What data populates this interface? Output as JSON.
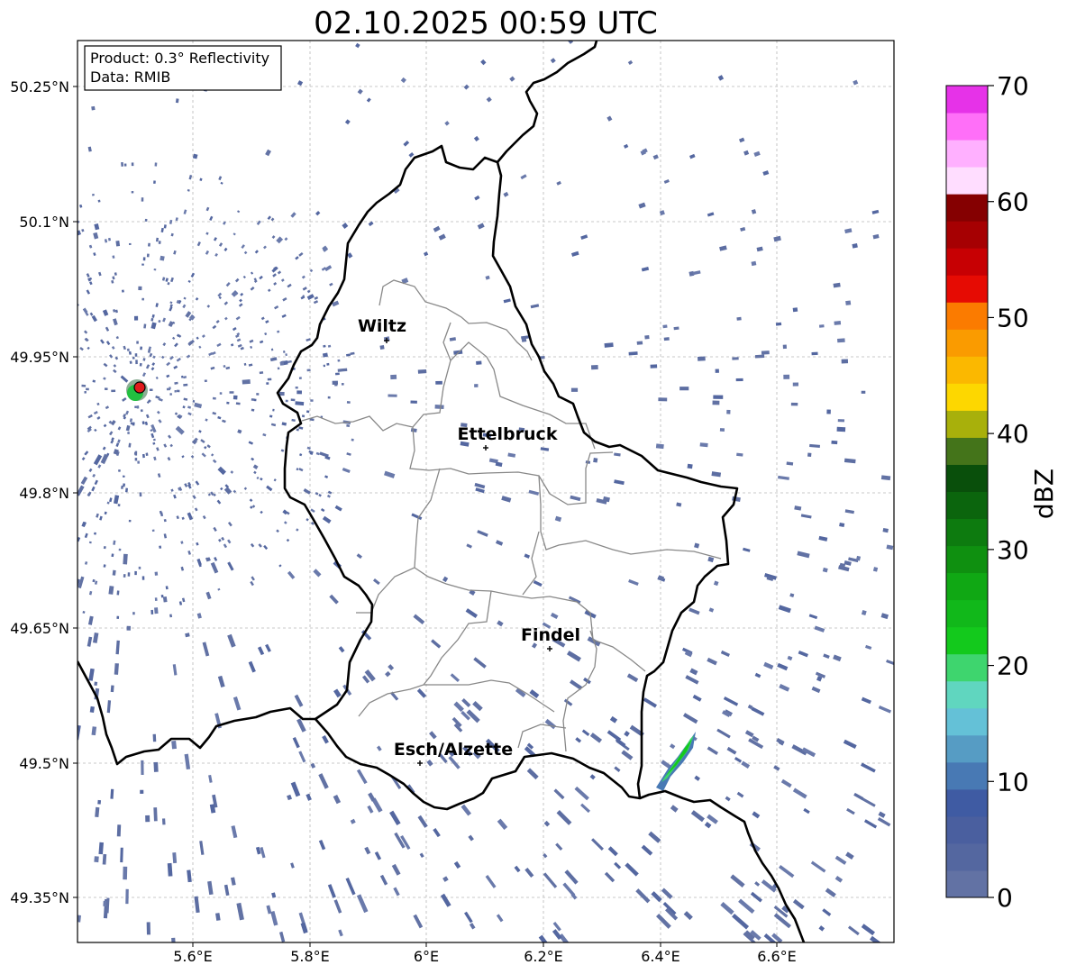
{
  "title": "02.10.2025 00:59 UTC",
  "info_box": {
    "product": "Product: 0.3° Reflectivity",
    "data": "Data: RMIB"
  },
  "axes": {
    "x_ticks": [
      "5.6°E",
      "5.8°E",
      "6°E",
      "6.2°E",
      "6.4°E",
      "6.6°E"
    ],
    "y_ticks": [
      "50.25°N",
      "50.1°N",
      "49.95°N",
      "49.8°N",
      "49.65°N",
      "49.5°N",
      "49.35°N"
    ]
  },
  "cities": [
    {
      "name": "Wiltz"
    },
    {
      "name": "Ettelbruck"
    },
    {
      "name": "Findel"
    },
    {
      "name": "Esch/Alzette"
    }
  ],
  "colorbar": {
    "label": "dBZ",
    "ticks": [
      "0",
      "10",
      "20",
      "30",
      "40",
      "50",
      "60",
      "70"
    ],
    "min": 0,
    "max": 70,
    "colors": [
      "#6272a4",
      "#5467a0",
      "#4a5f9f",
      "#3f5ba3",
      "#4879b4",
      "#569cc4",
      "#64c1d7",
      "#60d6bf",
      "#3ed56e",
      "#13c91c",
      "#11b81a",
      "#10a814",
      "#0f9010",
      "#0d7b0f",
      "#0b650d",
      "#094f0b",
      "#44741a",
      "#a8b00b",
      "#fdd700",
      "#fbb800",
      "#fa9b00",
      "#fb7b00",
      "#e60b03",
      "#c70003",
      "#a60002",
      "#850001",
      "#ffddff",
      "#ffb0ff",
      "#ff6ff8",
      "#e632e8"
    ]
  }
}
